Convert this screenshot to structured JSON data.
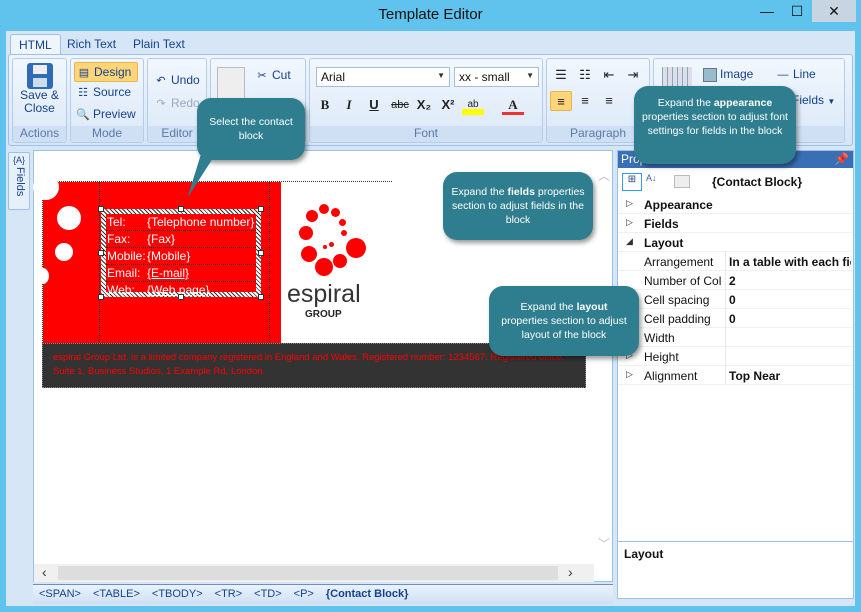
{
  "window": {
    "title": "Template Editor",
    "minimize": "—",
    "maximize": "☐",
    "close": "✕"
  },
  "ribbon": {
    "tabs": [
      {
        "label": "HTML",
        "active": true
      },
      {
        "label": "Rich Text"
      },
      {
        "label": "Plain Text"
      }
    ],
    "actions": {
      "save_close": "Save & Close",
      "group": "Actions"
    },
    "mode": {
      "design": "Design",
      "source": "Source",
      "preview": "Preview",
      "group": "Mode"
    },
    "editor": {
      "undo": "Undo",
      "redo": "Redo",
      "group": "Editor"
    },
    "clipboard": {
      "cut": "Cut"
    },
    "font": {
      "family": "Arial",
      "size": "xx - small",
      "bold": "B",
      "italic": "I",
      "underline": "U",
      "strike": "abc",
      "subscript": "X₂",
      "superscript": "X²",
      "highlight": "ab",
      "color": "A",
      "group": "Font"
    },
    "paragraph": {
      "group": "Paragraph"
    },
    "insert": {
      "image": "Image",
      "line": "Line",
      "fields": "Fields"
    }
  },
  "sidebar": {
    "fields_tab": "Fields",
    "fields_icon": "{A}"
  },
  "card": {
    "rows": [
      {
        "label": "Tel:",
        "value": "{Telephone number}"
      },
      {
        "label": "Fax:",
        "value": "{Fax}"
      },
      {
        "label": "Mobile:",
        "value": "{Mobile}"
      },
      {
        "label": "Email:",
        "value": "{E-mail}"
      },
      {
        "label": "Web:",
        "value": "{Web page}"
      }
    ],
    "logo_text": "espiral",
    "logo_sub": "GROUP",
    "footer": "espiral Group Ltd. is a limited company registered in England and Wales. Registered number: 1234567. Registered office: Suite 1, Business Studios, 1 Example Rd, London.",
    "colors": {
      "red": "#ff0000",
      "dark": "#333333"
    }
  },
  "properties": {
    "title": "Properties",
    "object": "{Contact Block}",
    "rows": [
      {
        "key": "Appearance",
        "value": "",
        "category": true,
        "expander": "▷"
      },
      {
        "key": "Fields",
        "value": "",
        "category": true,
        "expander": "▷"
      },
      {
        "key": "Layout",
        "value": "",
        "category": true,
        "expander": "◢"
      },
      {
        "key": "Arrangement",
        "value": "In a table with each field",
        "expander": ""
      },
      {
        "key": "Number of Col",
        "value": "2",
        "expander": ""
      },
      {
        "key": "Cell spacing",
        "value": "0",
        "expander": ""
      },
      {
        "key": "Cell padding",
        "value": "0",
        "expander": ""
      },
      {
        "key": "Width",
        "value": "",
        "expander": ""
      },
      {
        "key": "Height",
        "value": "",
        "expander": "▷"
      },
      {
        "key": "Alignment",
        "value": "Top Near",
        "expander": "▷"
      }
    ],
    "description": "Layout"
  },
  "breadcrumb": [
    "<SPAN>",
    "<TABLE>",
    "<TBODY>",
    "<TR>",
    "<TD>",
    "<P>",
    "{Contact Block}"
  ],
  "callouts": {
    "select": "Select the contact block",
    "appearance_pre": "Expand the ",
    "appearance_b": "appearance",
    "appearance_post": " properties section to adjust font settings for fields in the block",
    "fields_pre": "Expand the ",
    "fields_b": "fields",
    "fields_post": " properties section to adjust fields in the block",
    "layout_pre": "Expand the ",
    "layout_b": "layout",
    "layout_post": " properties section to adjust layout of the block"
  }
}
